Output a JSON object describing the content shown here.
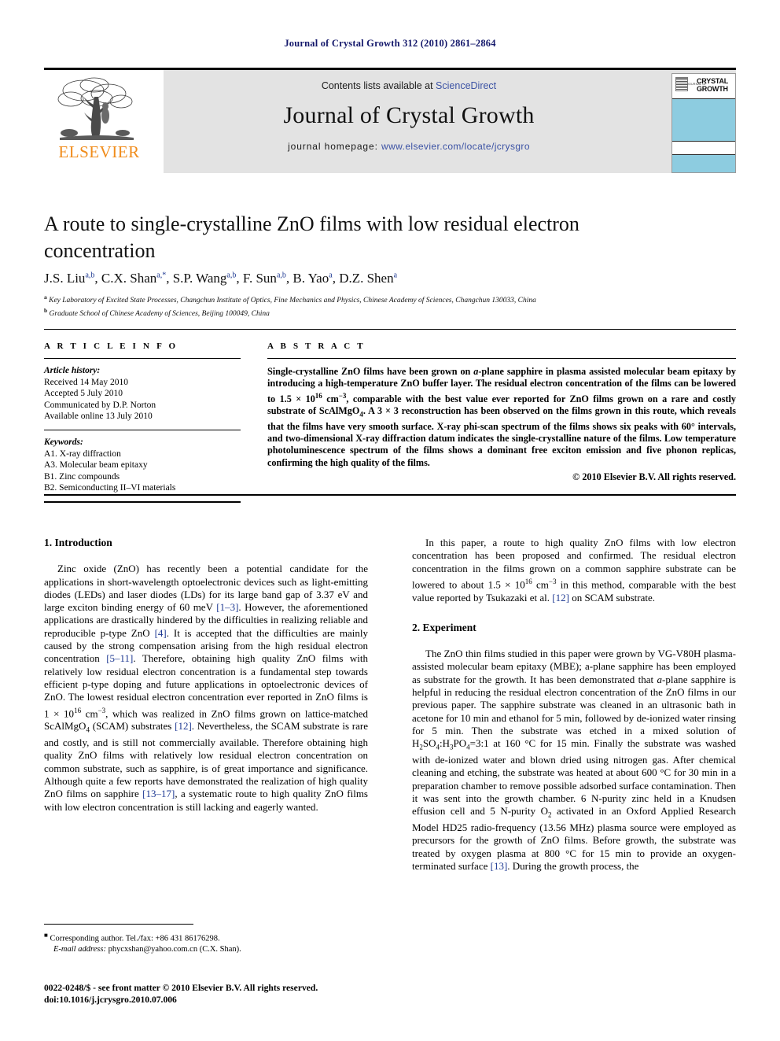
{
  "running_head": "Journal of Crystal Growth 312 (2010) 2861–2864",
  "masthead": {
    "publisher_name": "ELSEVIER",
    "contents_prefix": "Contents lists available at ",
    "contents_link": "ScienceDirect",
    "journal_name": "Journal of Crystal Growth",
    "homepage_prefix": "journal homepage: ",
    "homepage_url": "www.elsevier.com/locate/jcrysgro",
    "cover": {
      "journal_word": "JOURNAL OF",
      "title": "CRYSTAL GROWTH"
    }
  },
  "article": {
    "title": "A route to single-crystalline ZnO films with low residual electron concentration",
    "affiliation_a": "Key Laboratory of Excited State Processes, Changchun Institute of Optics, Fine Mechanics and Physics, Chinese Academy of Sciences, Changchun 130033, China",
    "affiliation_b": "Graduate School of Chinese Academy of Sciences, Beijing 100049, China"
  },
  "info": {
    "kicker": "A R T I C L E    I N F O",
    "history_label": "Article history:",
    "history": [
      "Received 14 May 2010",
      "Accepted 5 July 2010",
      "Communicated by D.P. Norton",
      "Available online 13 July 2010"
    ],
    "keywords_label": "Keywords:",
    "keywords": [
      "A1. X-ray diffraction",
      "A3. Molecular beam epitaxy",
      "B1. Zinc compounds",
      "B2. Semiconducting II–VI materials"
    ]
  },
  "abstract": {
    "kicker": "A B S T R A C T",
    "copyright": "© 2010 Elsevier B.V. All rights reserved."
  },
  "sections": {
    "introduction_heading": "1.  Introduction",
    "experiment_heading": "2.  Experiment"
  },
  "footer": {
    "corresponding": "Corresponding author. Tel./fax: +86 431 86176298.",
    "email_label": "E-mail address:",
    "email": "phycxshan@yahoo.com.cn (C.X. Shan).",
    "issn_line": "0022-0248/$ - see front matter © 2010 Elsevier B.V. All rights reserved.",
    "doi_line": "doi:10.1016/j.jcrysgro.2010.07.006"
  },
  "colors": {
    "link": "#3b52a4",
    "citation": "#1f3a93",
    "running_head": "#14186b",
    "elsevier_orange": "#f08c1b",
    "cover_blue": "#8dcce0",
    "masthead_gray": "#e3e3e3"
  }
}
